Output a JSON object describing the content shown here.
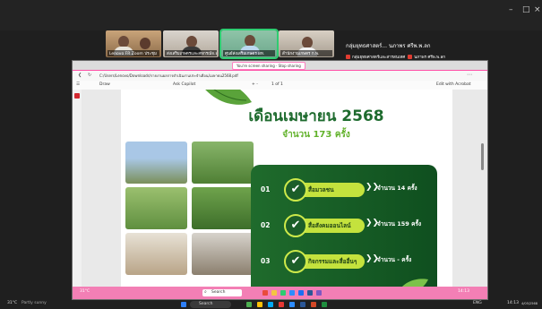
{
  "meeting": {
    "window_controls": [
      "–",
      "□",
      "×"
    ],
    "participants": [
      {
        "name": "Lenovo FR Zoom ประชุม"
      },
      {
        "name": "ส่งเสริมเกษตรและสหกรณ์จ.ลำพูน"
      },
      {
        "name": "ศูนย์ส่งเสริมเกษตร ผท."
      },
      {
        "name": "สำนักงานเกษตร ก.พ."
      }
    ],
    "group_label": "กลุ่มยุทธศาสตร์... นภาพร ศรีพ.พ.ลก",
    "group_sub": [
      "กลุ่มยุทธศาสตร์และสารสนเทศ",
      "นภาพร ศรีพ.พ.ลก"
    ]
  },
  "pdf_window": {
    "share_banner": "You're screen sharing · Stop sharing",
    "url": "C:/Users/Lenovo/Downloads/รายงานผลการดำเนินงานประจำเดือน/เมษายน2568.pdf",
    "toolbar": {
      "draw": "Draw",
      "ask_copilot": "Ask Copilot",
      "page_info": "1 of 1",
      "zoom": "+ - ",
      "edit_acrobat": "Edit with Acrobat"
    }
  },
  "slide": {
    "title": "เดือนเมษายน 2568",
    "subtitle": "จำนวน 173 ครั้ง",
    "rows": [
      {
        "num": "01",
        "label": "สื่อมวลชน",
        "arrows": "❯❯",
        "count": "จำนวน 14 ครั้ง"
      },
      {
        "num": "02",
        "label": "สื่อสังคมออนไลน์",
        "arrows": "❯❯",
        "count": "จำนวน 159 ครั้ง"
      },
      {
        "num": "03",
        "label": "กิจกรรมและสื่ออื่นๆ",
        "arrows": "❯❯",
        "count": "จำนวน - ครั้ง"
      }
    ]
  },
  "zoom_bar": {
    "weather": "31°C",
    "search": "Search",
    "clock": "14:13"
  },
  "win_taskbar": {
    "weather": "31°C",
    "weather_sub": "Partly sunny",
    "search": "Search",
    "lang": "ENG",
    "time": "14:13",
    "date": "4/05/2568"
  },
  "colors": {
    "accent_green": "#1e6b2e",
    "lime": "#c4e23d",
    "pink_bar": "#f37fb5",
    "active_tile": "#2ecc71"
  }
}
